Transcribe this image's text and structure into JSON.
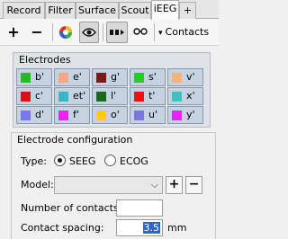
{
  "tabs": [
    {
      "label": "Record"
    },
    {
      "label": "Filter"
    },
    {
      "label": "Surface"
    },
    {
      "label": "Scout"
    },
    {
      "label": "iEEG"
    },
    {
      "label": "+"
    }
  ],
  "toolbar": {
    "add_label": "+",
    "remove_label": "−",
    "contacts_label": "Contacts",
    "color_icon": "color-wheel-icon",
    "eye_icon": "eye-icon",
    "display_icon": "electrode-display-icon",
    "link_icon": "link-icon",
    "dropdown_arrow": "▾"
  },
  "electrodes": {
    "title": "Electrodes",
    "items": [
      {
        "name": "b'",
        "color": "#22bb22"
      },
      {
        "name": "e'",
        "color": "#f7a87e"
      },
      {
        "name": "g'",
        "color": "#7a1a1a"
      },
      {
        "name": "s'",
        "color": "#22cc22"
      },
      {
        "name": "v'",
        "color": "#f7b27e"
      },
      {
        "name": "c'",
        "color": "#dd1111"
      },
      {
        "name": "et'",
        "color": "#3ab5c4"
      },
      {
        "name": "l'",
        "color": "#1a6a1a"
      },
      {
        "name": "t'",
        "color": "#ee1111"
      },
      {
        "name": "x'",
        "color": "#44c0c0"
      },
      {
        "name": "d'",
        "color": "#7777ee"
      },
      {
        "name": "f'",
        "color": "#ee22ee"
      },
      {
        "name": "o'",
        "color": "#ffcc00"
      },
      {
        "name": "u'",
        "color": "#7777dd"
      },
      {
        "name": "y'",
        "color": "#ee22ee"
      }
    ]
  },
  "config": {
    "title": "Electrode configuration",
    "type_label": "Type:",
    "seeg_label": "SEEG",
    "ecog_label": "ECOG",
    "model_label": "Model:",
    "model_value": "",
    "combo_arrow": "⌵",
    "add_label": "+",
    "remove_label": "−",
    "contacts_label": "Number of contacts:",
    "contacts_value": "",
    "spacing_label": "Contact spacing:",
    "spacing_value": "3.5",
    "spacing_unit": "mm"
  }
}
